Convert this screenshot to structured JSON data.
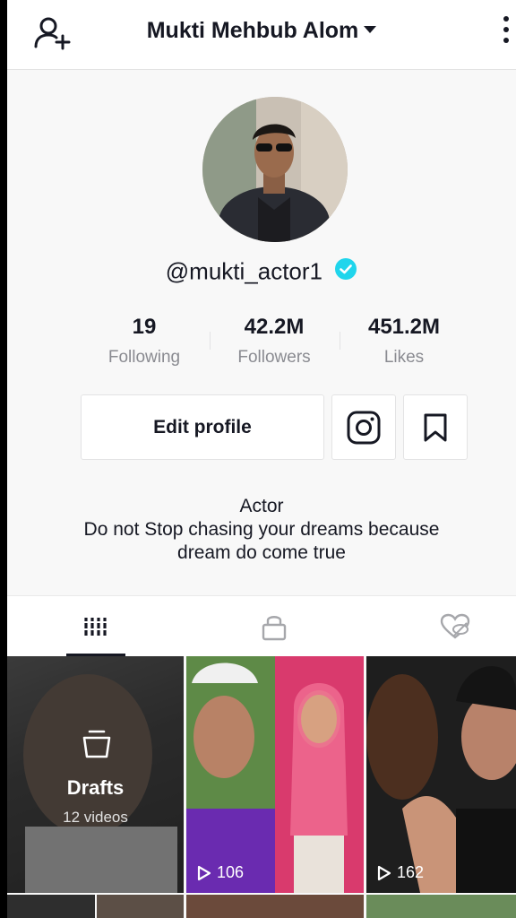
{
  "header": {
    "title": "Mukti Mehbub Alom",
    "add_user_icon": "add-user-icon",
    "more_icon": "more-vertical-icon"
  },
  "profile": {
    "username": "@mukti_actor1",
    "verified": true,
    "stats": [
      {
        "value": "19",
        "label": "Following"
      },
      {
        "value": "42.2M",
        "label": "Followers"
      },
      {
        "value": "451.2M",
        "label": "Likes"
      }
    ],
    "edit_profile_label": "Edit profile",
    "bio_title": "Actor",
    "bio_line1": "Do not Stop chasing your dreams because",
    "bio_line2": "dream do come true"
  },
  "tabs": [
    {
      "name": "videos",
      "icon": "grid-icon",
      "active": true
    },
    {
      "name": "private",
      "icon": "lock-icon",
      "active": false
    },
    {
      "name": "liked",
      "icon": "hidden-heart-icon",
      "active": false
    }
  ],
  "grid": {
    "drafts_label": "Drafts",
    "drafts_count": "12 videos",
    "tiles": [
      {
        "views": "106"
      },
      {
        "views": "162"
      }
    ]
  },
  "colors": {
    "accent_verified": "#20d5ec",
    "text_primary": "#161823",
    "text_secondary": "#8a8b91"
  }
}
